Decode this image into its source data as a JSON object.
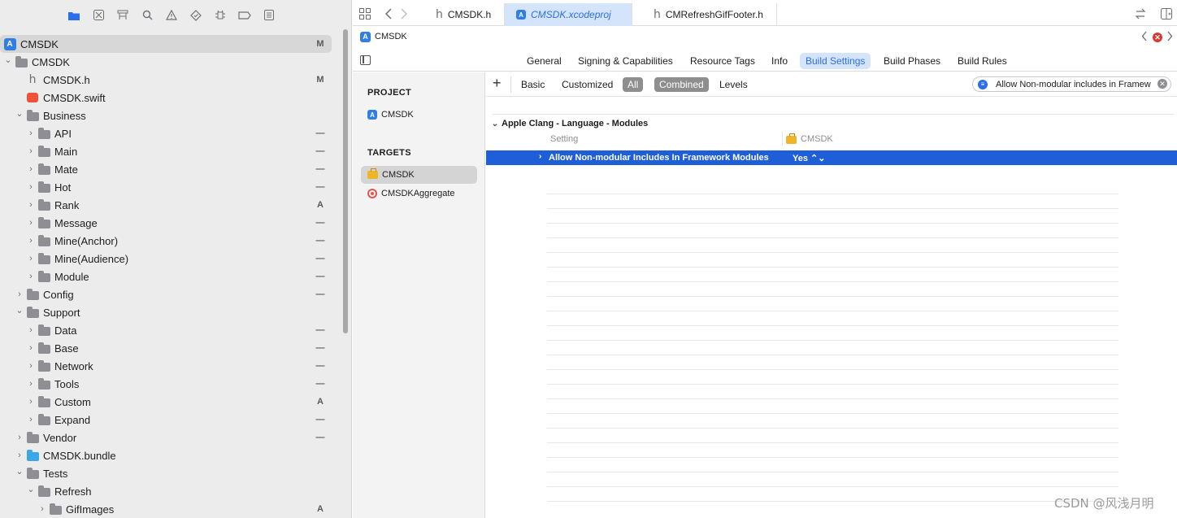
{
  "navigator": {
    "toolbar_icons": [
      "folder-icon",
      "source-control-icon",
      "symbol-icon",
      "search-icon",
      "issue-icon",
      "test-icon",
      "debug-icon",
      "breakpoint-icon",
      "report-icon"
    ],
    "tree": [
      {
        "label": "CMSDK",
        "badge": "M",
        "depth": 0,
        "kind": "project",
        "selected": true,
        "disclosure": ""
      },
      {
        "label": "CMSDK",
        "badge": "",
        "depth": 0,
        "kind": "folder",
        "disclosure": "open"
      },
      {
        "label": "CMSDK.h",
        "badge": "M",
        "depth": 1,
        "kind": "header",
        "disclosure": ""
      },
      {
        "label": "CMSDK.swift",
        "badge": "",
        "depth": 1,
        "kind": "swift",
        "disclosure": ""
      },
      {
        "label": "Business",
        "badge": "",
        "depth": 1,
        "kind": "folder",
        "disclosure": "open"
      },
      {
        "label": "API",
        "badge": "—",
        "depth": 2,
        "kind": "folder",
        "disclosure": "closed"
      },
      {
        "label": "Main",
        "badge": "—",
        "depth": 2,
        "kind": "folder",
        "disclosure": "closed"
      },
      {
        "label": "Mate",
        "badge": "—",
        "depth": 2,
        "kind": "folder",
        "disclosure": "closed"
      },
      {
        "label": "Hot",
        "badge": "—",
        "depth": 2,
        "kind": "folder",
        "disclosure": "closed"
      },
      {
        "label": "Rank",
        "badge": "A",
        "depth": 2,
        "kind": "folder",
        "disclosure": "closed"
      },
      {
        "label": "Message",
        "badge": "—",
        "depth": 2,
        "kind": "folder",
        "disclosure": "closed"
      },
      {
        "label": "Mine(Anchor)",
        "badge": "—",
        "depth": 2,
        "kind": "folder",
        "disclosure": "closed"
      },
      {
        "label": "Mine(Audience)",
        "badge": "—",
        "depth": 2,
        "kind": "folder",
        "disclosure": "closed"
      },
      {
        "label": "Module",
        "badge": "—",
        "depth": 2,
        "kind": "folder",
        "disclosure": "closed"
      },
      {
        "label": "Config",
        "badge": "—",
        "depth": 1,
        "kind": "folder",
        "disclosure": "closed"
      },
      {
        "label": "Support",
        "badge": "",
        "depth": 1,
        "kind": "folder",
        "disclosure": "open"
      },
      {
        "label": "Data",
        "badge": "—",
        "depth": 2,
        "kind": "folder",
        "disclosure": "closed"
      },
      {
        "label": "Base",
        "badge": "—",
        "depth": 2,
        "kind": "folder",
        "disclosure": "closed"
      },
      {
        "label": "Network",
        "badge": "—",
        "depth": 2,
        "kind": "folder",
        "disclosure": "closed"
      },
      {
        "label": "Tools",
        "badge": "—",
        "depth": 2,
        "kind": "folder",
        "disclosure": "closed"
      },
      {
        "label": "Custom",
        "badge": "A",
        "depth": 2,
        "kind": "folder",
        "disclosure": "closed"
      },
      {
        "label": "Expand",
        "badge": "—",
        "depth": 2,
        "kind": "folder",
        "disclosure": "closed"
      },
      {
        "label": "Vendor",
        "badge": "—",
        "depth": 1,
        "kind": "folder",
        "disclosure": "closed"
      },
      {
        "label": "CMSDK.bundle",
        "badge": "",
        "depth": 1,
        "kind": "bundle",
        "disclosure": "closed"
      },
      {
        "label": "Tests",
        "badge": "",
        "depth": 1,
        "kind": "folder",
        "disclosure": "open"
      },
      {
        "label": "Refresh",
        "badge": "",
        "depth": 2,
        "kind": "folder",
        "disclosure": "open"
      },
      {
        "label": "GifImages",
        "badge": "A",
        "depth": 3,
        "kind": "folder",
        "disclosure": "closed"
      }
    ]
  },
  "tabs": [
    {
      "label": "CMSDK.h",
      "glyph": "h",
      "active": false
    },
    {
      "label": "CMSDK.xcodeproj",
      "glyph": "A",
      "active": true
    },
    {
      "label": "CMRefreshGifFooter.h",
      "glyph": "h",
      "active": false
    }
  ],
  "jumpbar": {
    "label": "CMSDK"
  },
  "settings_tabs": [
    {
      "label": "General",
      "active": false
    },
    {
      "label": "Signing & Capabilities",
      "active": false
    },
    {
      "label": "Resource Tags",
      "active": false
    },
    {
      "label": "Info",
      "active": false
    },
    {
      "label": "Build Settings",
      "active": true
    },
    {
      "label": "Build Phases",
      "active": false
    },
    {
      "label": "Build Rules",
      "active": false
    }
  ],
  "targets_panel": {
    "project_header": "PROJECT",
    "project_item": "CMSDK",
    "targets_header": "TARGETS",
    "targets": [
      {
        "label": "CMSDK",
        "selected": true,
        "icon": "toolbox-icon"
      },
      {
        "label": "CMSDKAggregate",
        "selected": false,
        "icon": "target-icon"
      }
    ]
  },
  "filter": {
    "plus": "+",
    "buttons": [
      {
        "label": "Basic",
        "on": false
      },
      {
        "label": "Customized",
        "on": false
      },
      {
        "label": "All",
        "on": true
      },
      {
        "label": "Combined",
        "on": true
      },
      {
        "label": "Levels",
        "on": false
      }
    ],
    "search_value": "Allow Non-modular includes in Framew"
  },
  "build_settings": {
    "section_title": "Apple Clang - Language - Modules",
    "column_setting": "Setting",
    "column_target": "CMSDK",
    "row": {
      "name": "Allow Non-modular Includes In Framework Modules",
      "value": "Yes ⌃⌄"
    }
  },
  "watermark": "CSDN @风浅月明",
  "colors": {
    "accent": "#2b6ee9",
    "selection": "#1e5fd9",
    "navigator_bg": "#ececec"
  }
}
